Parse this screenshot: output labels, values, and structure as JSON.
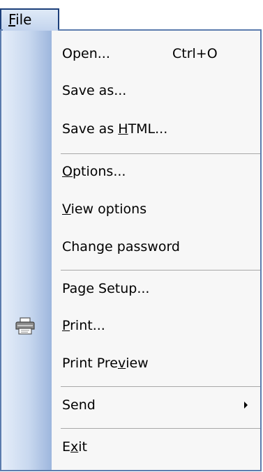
{
  "tab": {
    "pre": "",
    "mnemonic": "F",
    "post": "ile"
  },
  "menu": {
    "open": {
      "label": "Open...",
      "shortcut": "Ctrl+O"
    },
    "save_as": {
      "label": "Save as..."
    },
    "save_html": {
      "pre": "Save as ",
      "mnemonic": "H",
      "post": "TML..."
    },
    "options": {
      "pre": "",
      "mnemonic": "O",
      "post": "ptions..."
    },
    "view_options": {
      "pre": "",
      "mnemonic": "V",
      "post": "iew options"
    },
    "change_password": {
      "label": "Change password"
    },
    "page_setup": {
      "pre": "Pa",
      "mnemonic": "g",
      "post": "e Setup..."
    },
    "print": {
      "pre": "",
      "mnemonic": "P",
      "post": "rint...",
      "icon": "printer-icon"
    },
    "print_preview": {
      "pre": "Print Pre",
      "mnemonic": "v",
      "post": "iew"
    },
    "send": {
      "label": "Send",
      "submenu_icon": "submenu-arrow-icon"
    },
    "exit": {
      "pre": "E",
      "mnemonic": "x",
      "post": "it"
    }
  },
  "colors": {
    "gutter_light": "#e6eef9",
    "gutter_dark": "#9db6dd",
    "border": "#5b7cae",
    "tab_border": "#1c3f7a"
  }
}
